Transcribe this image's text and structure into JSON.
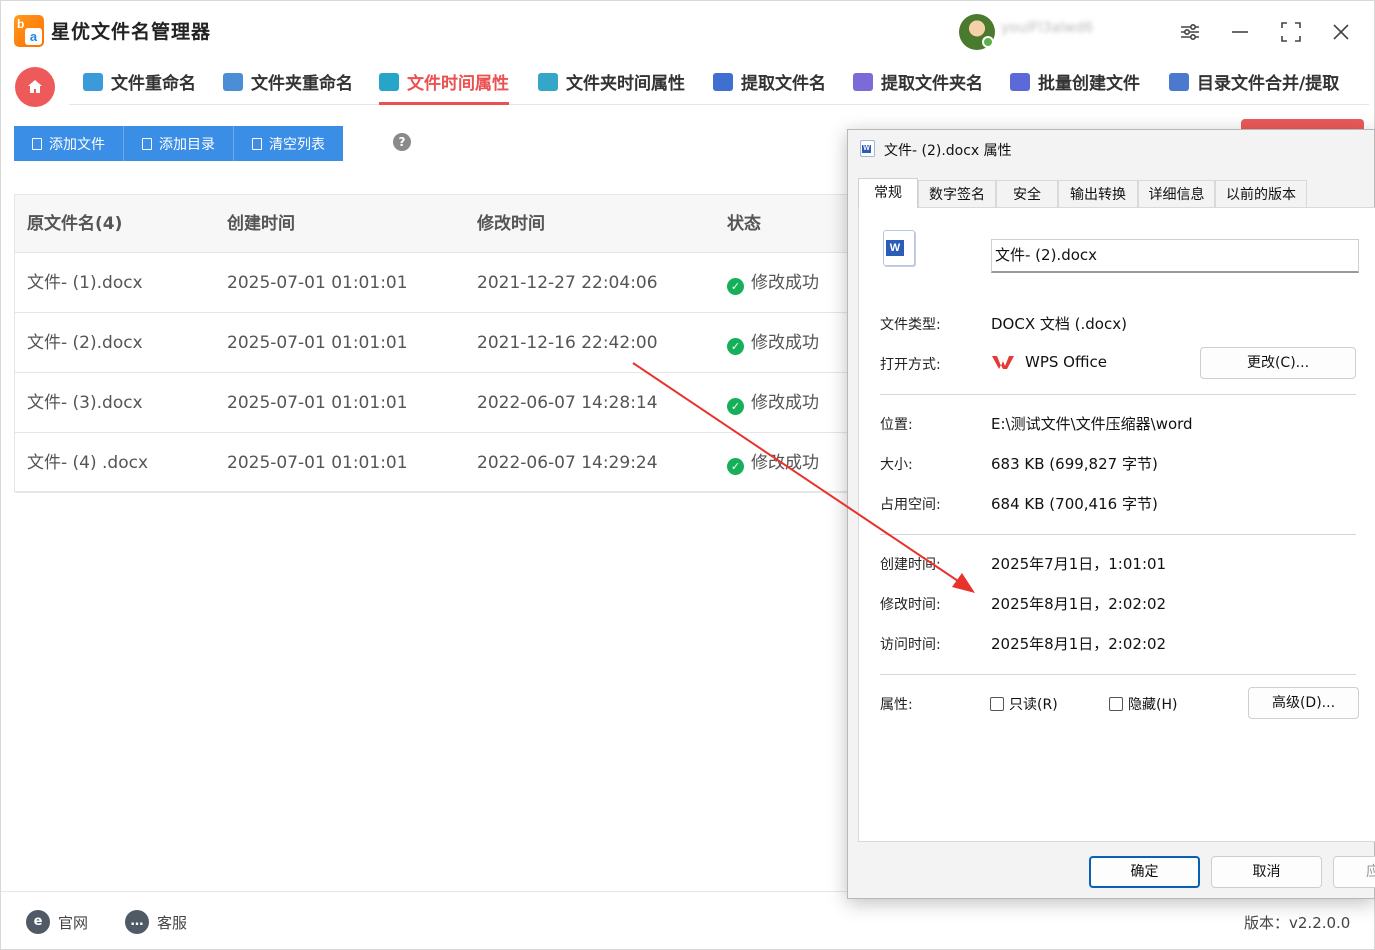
{
  "app": {
    "title": "星优文件名管理器",
    "username": "youlFl3alwd6"
  },
  "nav": {
    "items": [
      {
        "label": "文件重命名",
        "color": "#3b9ad9"
      },
      {
        "label": "文件夹重命名",
        "color": "#4a8fd6"
      },
      {
        "label": "文件时间属性",
        "color": "#26a5c9"
      },
      {
        "label": "文件夹时间属性",
        "color": "#35a6c8"
      },
      {
        "label": "提取文件名",
        "color": "#3f6fd1"
      },
      {
        "label": "提取文件夹名",
        "color": "#7a6bd6"
      },
      {
        "label": "批量创建文件",
        "color": "#5b69d9"
      },
      {
        "label": "目录文件合并/提取",
        "color": "#4b79cf"
      }
    ],
    "active_index": 2,
    "active_color": "#ec5050"
  },
  "toolbar": {
    "add_file": "添加文件",
    "add_dir": "添加目录",
    "clear_list": "清空列表",
    "help": "?"
  },
  "table": {
    "headers": [
      "原文件名(4)",
      "创建时间",
      "修改时间",
      "状态"
    ],
    "rows": [
      [
        "文件- (1).docx",
        "2025-07-01 01:01:01",
        "2021-12-27 22:04:06",
        "修改成功"
      ],
      [
        "文件- (2).docx",
        "2025-07-01 01:01:01",
        "2021-12-16 22:42:00",
        "修改成功"
      ],
      [
        "文件- (3).docx",
        "2025-07-01 01:01:01",
        "2022-06-07 14:28:14",
        "修改成功"
      ],
      [
        "文件- (4) .docx",
        "2025-07-01 01:01:01",
        "2022-06-07 14:29:24",
        "修改成功"
      ]
    ],
    "status_color": "#17b05a"
  },
  "footer": {
    "website": "官网",
    "support": "客服",
    "version": "版本：v2.2.0.0"
  },
  "dialog": {
    "title": "文件- (2).docx 属性",
    "tabs": [
      "常规",
      "数字签名",
      "安全",
      "输出转换",
      "详细信息",
      "以前的版本"
    ],
    "filename": "文件- (2).docx",
    "type_label": "文件类型:",
    "type_value": "DOCX 文档 (.docx)",
    "open_label": "打开方式:",
    "open_value": "WPS Office",
    "change_btn": "更改(C)...",
    "location_label": "位置:",
    "location_value": "E:\\测试文件\\文件压缩器\\word",
    "size_label": "大小:",
    "size_value": "683 KB (699,827 字节)",
    "disk_label": "占用空间:",
    "disk_value": "684 KB (700,416 字节)",
    "created_label": "创建时间:",
    "created_value": "2025年7月1日，1:01:01",
    "modified_label": "修改时间:",
    "modified_value": "2025年8月1日，2:02:02",
    "accessed_label": "访问时间:",
    "accessed_value": "2025年8月1日，2:02:02",
    "attr_label": "属性:",
    "readonly": "只读(R)",
    "hidden": "隐藏(H)",
    "advanced_btn": "高级(D)...",
    "ok": "确定",
    "cancel": "取消",
    "apply": "应"
  }
}
